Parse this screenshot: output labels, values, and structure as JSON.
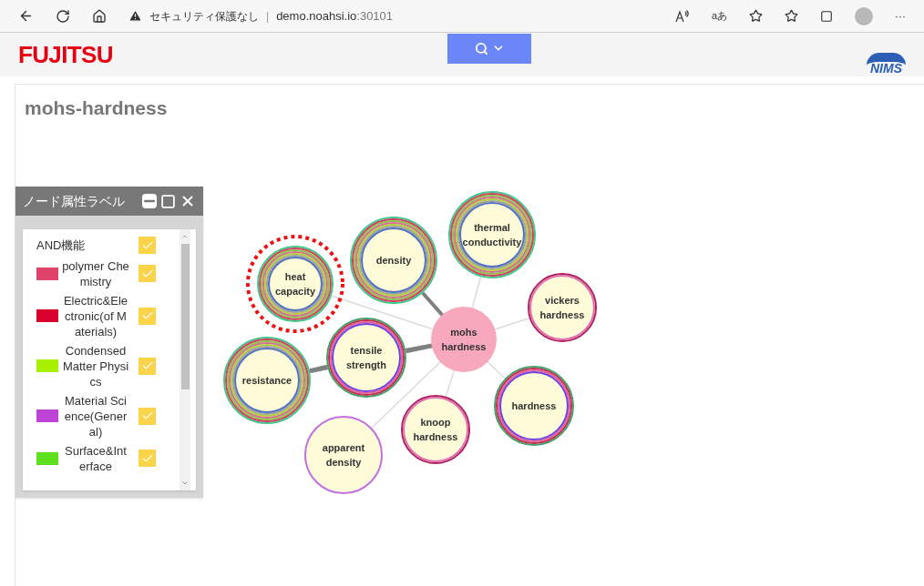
{
  "browser": {
    "security": "セキュリティ保護なし",
    "separator": "|",
    "url_host": "demo.noahsi.io",
    "url_port": ":30101",
    "translate": "aあ",
    "more": "···"
  },
  "header": {
    "left_logo": "FUJITSU",
    "right_logo": "NIMS"
  },
  "page_title": "mohs-hardness",
  "label_panel": {
    "title": "ノード属性ラベル",
    "items": [
      {
        "kind": "option",
        "label": "AND機能",
        "checked": true
      },
      {
        "kind": "category",
        "label": "polymer Chemistry",
        "color": "#e0436a",
        "checked": true
      },
      {
        "kind": "category",
        "label": "Electric&Electronic(of Materials)",
        "color": "#d9002e",
        "checked": true
      },
      {
        "kind": "category",
        "label": "Condensed Matter Physics",
        "color": "#a6f000",
        "checked": true
      },
      {
        "kind": "category",
        "label": "Material Science(General)",
        "color": "#bd44d6",
        "checked": true
      },
      {
        "kind": "category",
        "label": "Surface&Interface",
        "color": "#5ee01e",
        "checked": true
      }
    ]
  },
  "graph": {
    "nodes": [
      {
        "kind": "center",
        "label": "mohs hardness",
        "selected": false
      },
      {
        "kind": "multiring",
        "label": "heat capacity",
        "strong_link": false,
        "selected": true
      },
      {
        "kind": "multiring",
        "label": "density",
        "strong_link": true,
        "selected": false
      },
      {
        "kind": "multiring",
        "label": "thermal conductivity",
        "strong_link": false,
        "selected": false
      },
      {
        "kind": "doublering",
        "label": "vickers hardness",
        "strong_link": false,
        "selected": false
      },
      {
        "kind": "fewring",
        "label": "tensile strength",
        "strong_link": true,
        "selected": false
      },
      {
        "kind": "multiring",
        "label": "resistance",
        "strong_link": true,
        "selected": false
      },
      {
        "kind": "fewring",
        "label": "hardness",
        "strong_link": false,
        "selected": false
      },
      {
        "kind": "doublering",
        "label": "knoop hardness",
        "strong_link": false,
        "selected": false
      },
      {
        "kind": "singlering",
        "label": "apparent density",
        "strong_link": false,
        "selected": false
      }
    ]
  }
}
